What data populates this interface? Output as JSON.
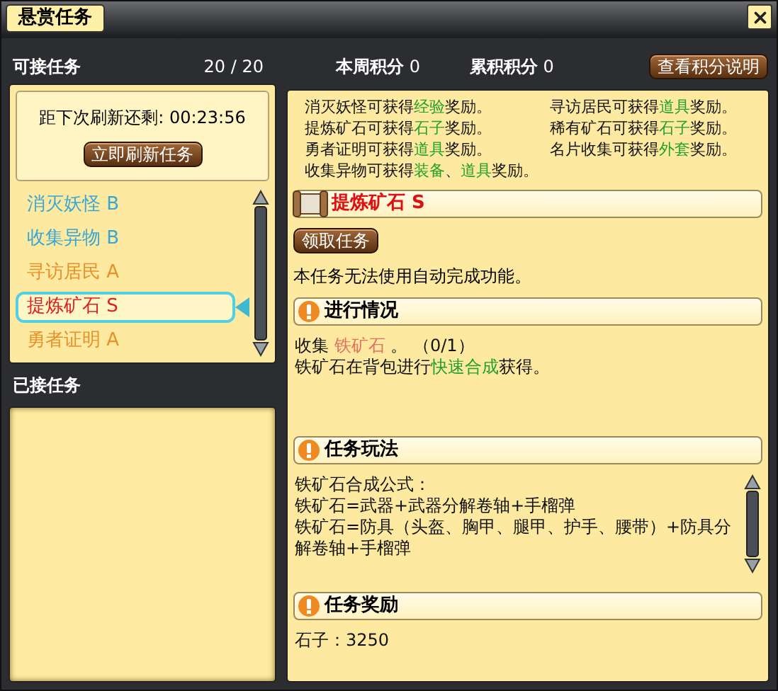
{
  "window": {
    "title": "悬赏任务"
  },
  "available": {
    "label": "可接任务",
    "count": "20 / 20",
    "refresh_label": "距下次刷新还剩: 00:23:56",
    "refresh_button": "立即刷新任务",
    "quests": [
      {
        "name": "消灭妖怪 B",
        "color": "#3aa6d6",
        "selected": false
      },
      {
        "name": "收集异物 B",
        "color": "#3aa6d6",
        "selected": false
      },
      {
        "name": "寻访居民 A",
        "color": "#e8902a",
        "selected": false
      },
      {
        "name": "提炼矿石 S",
        "color": "#e02020",
        "selected": true
      },
      {
        "name": "勇者证明 A",
        "color": "#e8902a",
        "selected": false
      }
    ]
  },
  "points": [
    {
      "label": "本周积分",
      "value": "0"
    },
    {
      "label": "累积积分",
      "value": "0"
    }
  ],
  "points_button": "查看积分说明",
  "accepted": {
    "label": "已接任务"
  },
  "reward_info": [
    [
      {
        "text": "消灭妖怪可获得",
        "kind": "plain"
      },
      {
        "text": "经验",
        "kind": "reward"
      },
      {
        "text": "奖励。",
        "kind": "plain"
      }
    ],
    [
      {
        "text": "寻访居民可获得",
        "kind": "plain"
      },
      {
        "text": "道具",
        "kind": "reward"
      },
      {
        "text": "奖励。",
        "kind": "plain"
      }
    ],
    [
      {
        "text": "提炼矿石可获得",
        "kind": "plain"
      },
      {
        "text": "石子",
        "kind": "reward"
      },
      {
        "text": "奖励。",
        "kind": "plain"
      }
    ],
    [
      {
        "text": "稀有矿石可获得",
        "kind": "plain"
      },
      {
        "text": "石子",
        "kind": "reward"
      },
      {
        "text": "奖励。",
        "kind": "plain"
      }
    ],
    [
      {
        "text": "勇者证明可获得",
        "kind": "plain"
      },
      {
        "text": "道具",
        "kind": "reward"
      },
      {
        "text": "奖励。",
        "kind": "plain"
      }
    ],
    [
      {
        "text": "名片收集可获得",
        "kind": "plain"
      },
      {
        "text": "外套",
        "kind": "reward"
      },
      {
        "text": "奖励。",
        "kind": "plain"
      }
    ],
    [
      {
        "text": "收集异物可获得",
        "kind": "plain"
      },
      {
        "text": "装备",
        "kind": "reward"
      },
      {
        "text": "、",
        "kind": "plain"
      },
      {
        "text": "道具",
        "kind": "reward"
      },
      {
        "text": "奖励。",
        "kind": "plain"
      }
    ]
  ],
  "quest": {
    "title": "提炼矿石 S",
    "accept_button": "领取任务",
    "note": "本任务无法使用自动完成功能。"
  },
  "sections": [
    {
      "title": "进行情况",
      "scrollable": false,
      "lines": [
        [
          {
            "text": "收集 ",
            "kind": "plain"
          },
          {
            "text": "铁矿石",
            "kind": "item"
          },
          {
            "text": " 。 （0/1）",
            "kind": "plain"
          }
        ],
        [
          {
            "text": "铁矿石在背包进行",
            "kind": "plain"
          },
          {
            "text": "快速合成",
            "kind": "reward"
          },
          {
            "text": "获得。",
            "kind": "plain"
          }
        ]
      ]
    },
    {
      "title": "任务玩法",
      "scrollable": true,
      "lines": [
        [
          {
            "text": "铁矿石合成公式：",
            "kind": "plain"
          }
        ],
        [
          {
            "text": "铁矿石=武器+武器分解卷轴+手榴弹",
            "kind": "plain"
          }
        ],
        [
          {
            "text": "铁矿石=防具（头盔、胸甲、腿甲、护手、腰带）+防具分解卷轴+手榴弹",
            "kind": "plain"
          }
        ]
      ]
    },
    {
      "title": "任务奖励",
      "scrollable": false,
      "lines": [
        [
          {
            "text": "石子：3250",
            "kind": "plain"
          }
        ]
      ]
    }
  ]
}
